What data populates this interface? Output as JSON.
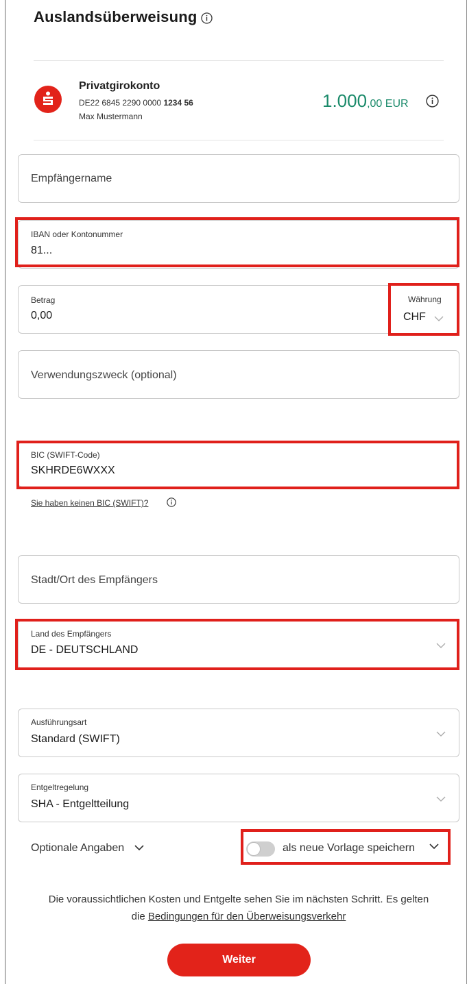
{
  "page": {
    "title": "Auslandsüberweisung"
  },
  "account": {
    "name": "Privatgirokonto",
    "iban_prefix": "DE22 6845 2290 0000 ",
    "iban_suffix": "1234 56",
    "holder": "Max Mustermann",
    "balance_int": "1.000",
    "balance_dec": ",00",
    "balance_currency": " EUR",
    "logo_glyph": "Ş"
  },
  "form": {
    "recipient_name": {
      "placeholder": "Empfängername"
    },
    "iban": {
      "label": "IBAN oder Kontonummer",
      "value": "81..."
    },
    "amount": {
      "label": "Betrag",
      "value": "0,00"
    },
    "currency": {
      "label": "Währung",
      "value": "CHF"
    },
    "purpose": {
      "placeholder": "Verwendungszweck (optional)"
    },
    "bic": {
      "label": "BIC (SWIFT-Code)",
      "value": "SKHRDE6WXXX"
    },
    "bic_help_link": "Sie haben keinen BIC (SWIFT)?",
    "city": {
      "placeholder": "Stadt/Ort des Empfängers"
    },
    "country": {
      "label": "Land des Empfängers",
      "value": "DE - DEUTSCHLAND"
    },
    "execution": {
      "label": "Ausführungsart",
      "value": "Standard (SWIFT)"
    },
    "fees": {
      "label": "Entgeltregelung",
      "value": "SHA - Entgeltteilung"
    },
    "optional_label": "Optionale Angaben",
    "template_toggle_label": "als neue Vorlage speichern",
    "template_toggle_on": false
  },
  "footer": {
    "note_text": "Die voraussichtlichen Kosten und Entgelte sehen Sie im nächsten Schritt. Es gelten die ",
    "note_link": "Bedingungen für den Überweisungsverkehr",
    "submit_label": "Weiter"
  },
  "colors": {
    "brand_red": "#e2231a",
    "balance_green": "#1a8a6a",
    "highlight_red": "#e0201b"
  },
  "icons": [
    "info-icon",
    "sparkasse-logo-icon",
    "chevron-down-icon"
  ]
}
